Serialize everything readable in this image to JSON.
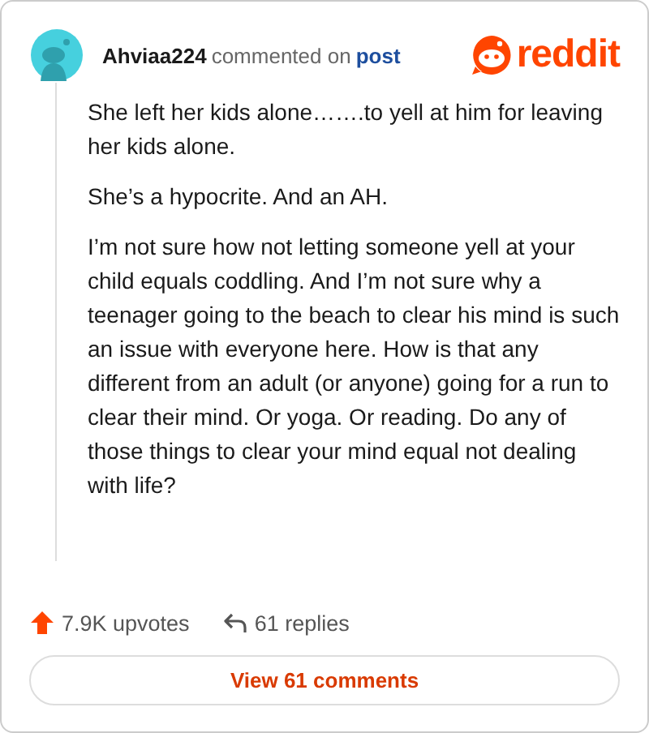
{
  "header": {
    "username": "Ahviaa224",
    "action": "commented on",
    "link": "post",
    "logo": "reddit"
  },
  "paragraphs": [
    "She left her kids alone…….to yell at him for leaving her kids alone.",
    "She’s a hypocrite. And an AH.",
    "I’m not sure how not letting someone yell at your child equals coddling. And I’m not sure why a teenager going to the beach to clear his mind is such an issue with everyone here. How is that any different from an adult (or anyone) going for a run to clear their mind. Or yoga. Or reading. Do any of those things to clear your mind equal not dealing with life?"
  ],
  "footer": {
    "upvotes": "7.9K upvotes",
    "replies": "61 replies"
  },
  "button": "View 61 comments"
}
